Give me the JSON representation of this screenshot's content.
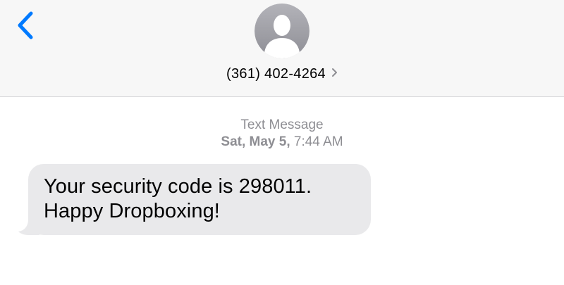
{
  "header": {
    "back_icon": "chevron-left-icon",
    "avatar_icon": "person-silhouette-icon",
    "contact_number": "(361) 402-4264",
    "contact_chevron_icon": "chevron-right-icon"
  },
  "thread": {
    "service_label": "Text Message",
    "date_label": "Sat, May 5,",
    "time_label": "7:44 AM"
  },
  "messages": [
    {
      "direction": "incoming",
      "lines": [
        "Your security code is 298011.",
        "Happy Dropboxing!"
      ]
    }
  ],
  "colors": {
    "accent": "#007aff",
    "header_bg": "#f7f7f7",
    "bubble_incoming": "#e9e9eb",
    "meta_text": "#8e8e93",
    "avatar_bg": "#a6a6ac"
  }
}
